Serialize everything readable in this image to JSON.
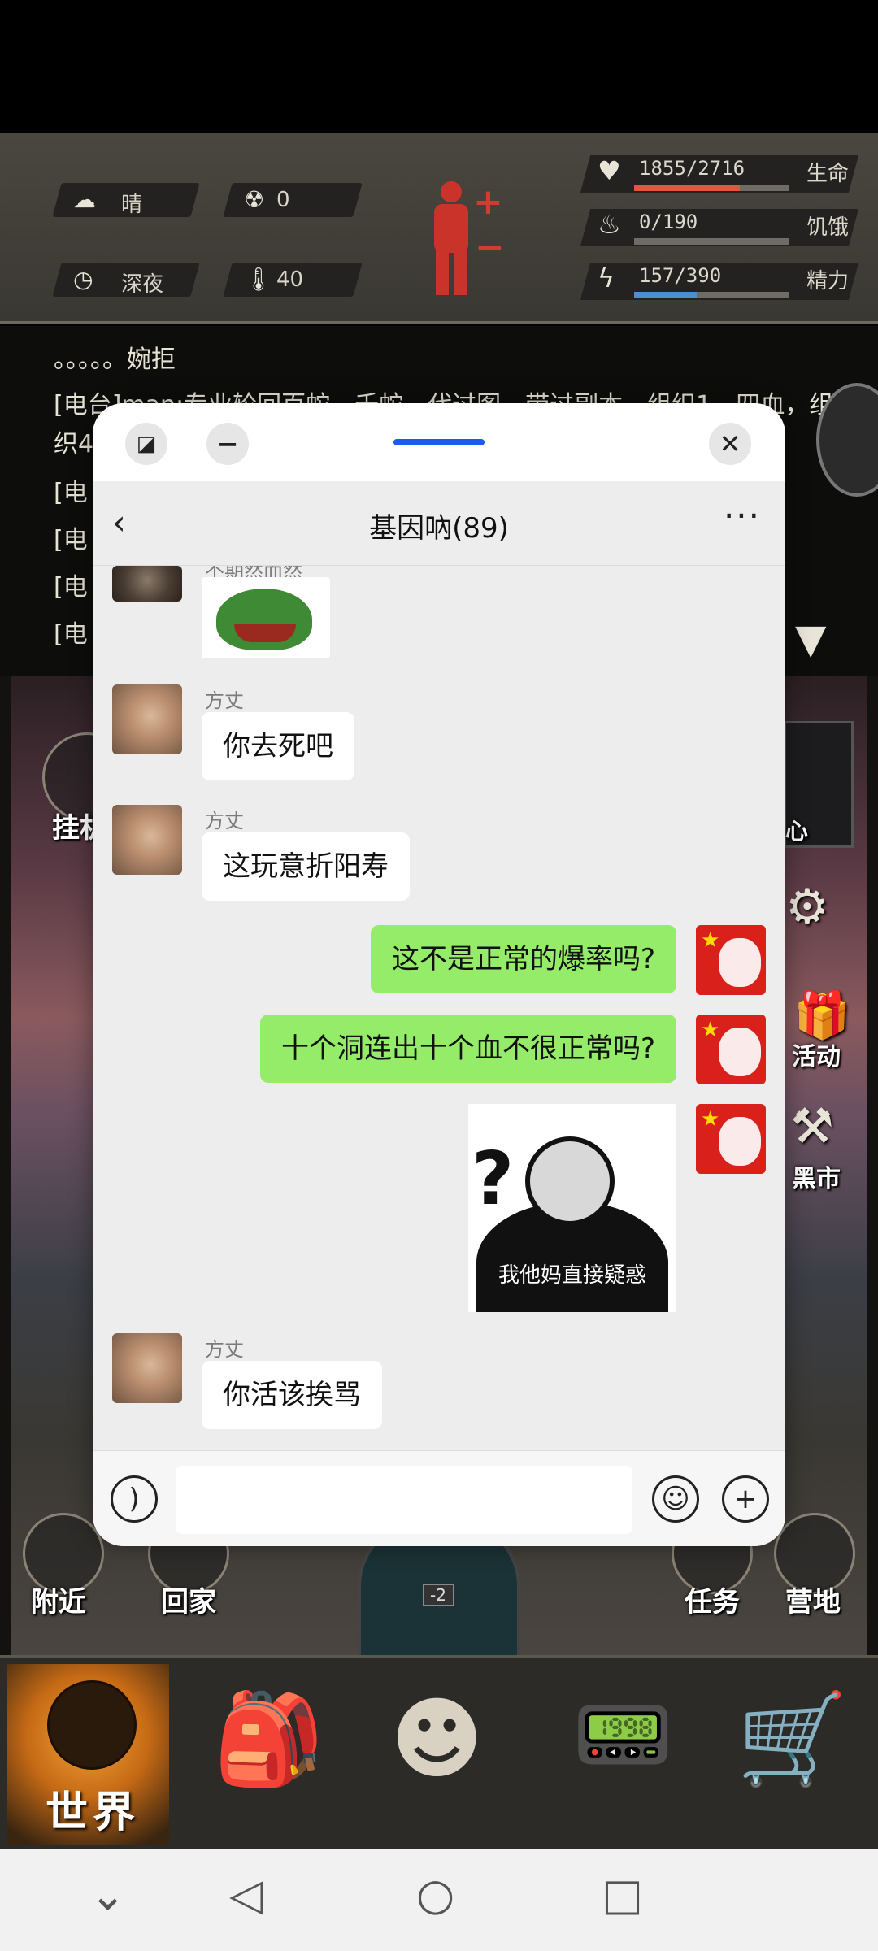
{
  "game": {
    "weather": "晴",
    "radiation": "0",
    "time_of_day": "深夜",
    "temperature": "40",
    "stats": [
      {
        "label": "生命",
        "value_text": "1855/2716",
        "fraction": 0.683,
        "color": "#e0573f"
      },
      {
        "label": "饥饿",
        "value_text": "0/190",
        "fraction": 0.0,
        "color": "#cc9a55"
      },
      {
        "label": "精力",
        "value_text": "157/390",
        "fraction": 0.403,
        "color": "#4a8fd0"
      }
    ],
    "chat_log": [
      "。。。。。婉拒",
      "[电台]man:专业轮回百蛇，千蛇，代过图，带过副本，组织1，四血，组",
      "织4",
      "[电",
      "[电",
      "[电",
      "[电"
    ],
    "side_labels": {
      "hang": "挂机",
      "nearby": "附近",
      "home": "回家",
      "task": "任务",
      "camp": "营地",
      "center": "心",
      "activity": "活动",
      "market": "黑市"
    },
    "map_level": "-2",
    "world_label": "世界"
  },
  "chat": {
    "title": "基因吶(89)",
    "messages": [
      {
        "sender": "不期然而然",
        "type": "sticker",
        "direction": "in"
      },
      {
        "sender": "方丈",
        "type": "text",
        "text": "你去死吧",
        "direction": "in"
      },
      {
        "sender": "方丈",
        "type": "text",
        "text": "这玩意折阳寿",
        "direction": "in"
      },
      {
        "type": "text",
        "text": "这不是正常的爆率吗?",
        "direction": "out"
      },
      {
        "type": "text",
        "text": "十个洞连出十个血不很正常吗?",
        "direction": "out"
      },
      {
        "type": "sticker",
        "caption": "我他妈直接疑惑",
        "direction": "out"
      },
      {
        "sender": "方丈",
        "type": "text",
        "text": "你活该挨骂",
        "direction": "in"
      }
    ],
    "input": {
      "value": "",
      "placeholder": ""
    }
  },
  "icons": [
    "sun-cloud-icon",
    "radiation-icon",
    "clock-icon",
    "thermometer-icon",
    "heart-icon",
    "stomach-icon",
    "lightning-icon",
    "body-icon",
    "back-icon",
    "more-icon",
    "voice-icon",
    "emoji-icon",
    "plus-icon",
    "backpack-icon",
    "head-gears-icon",
    "radio-icon",
    "cart-icon",
    "gear-icon",
    "gift-icon",
    "hammer-icon"
  ]
}
